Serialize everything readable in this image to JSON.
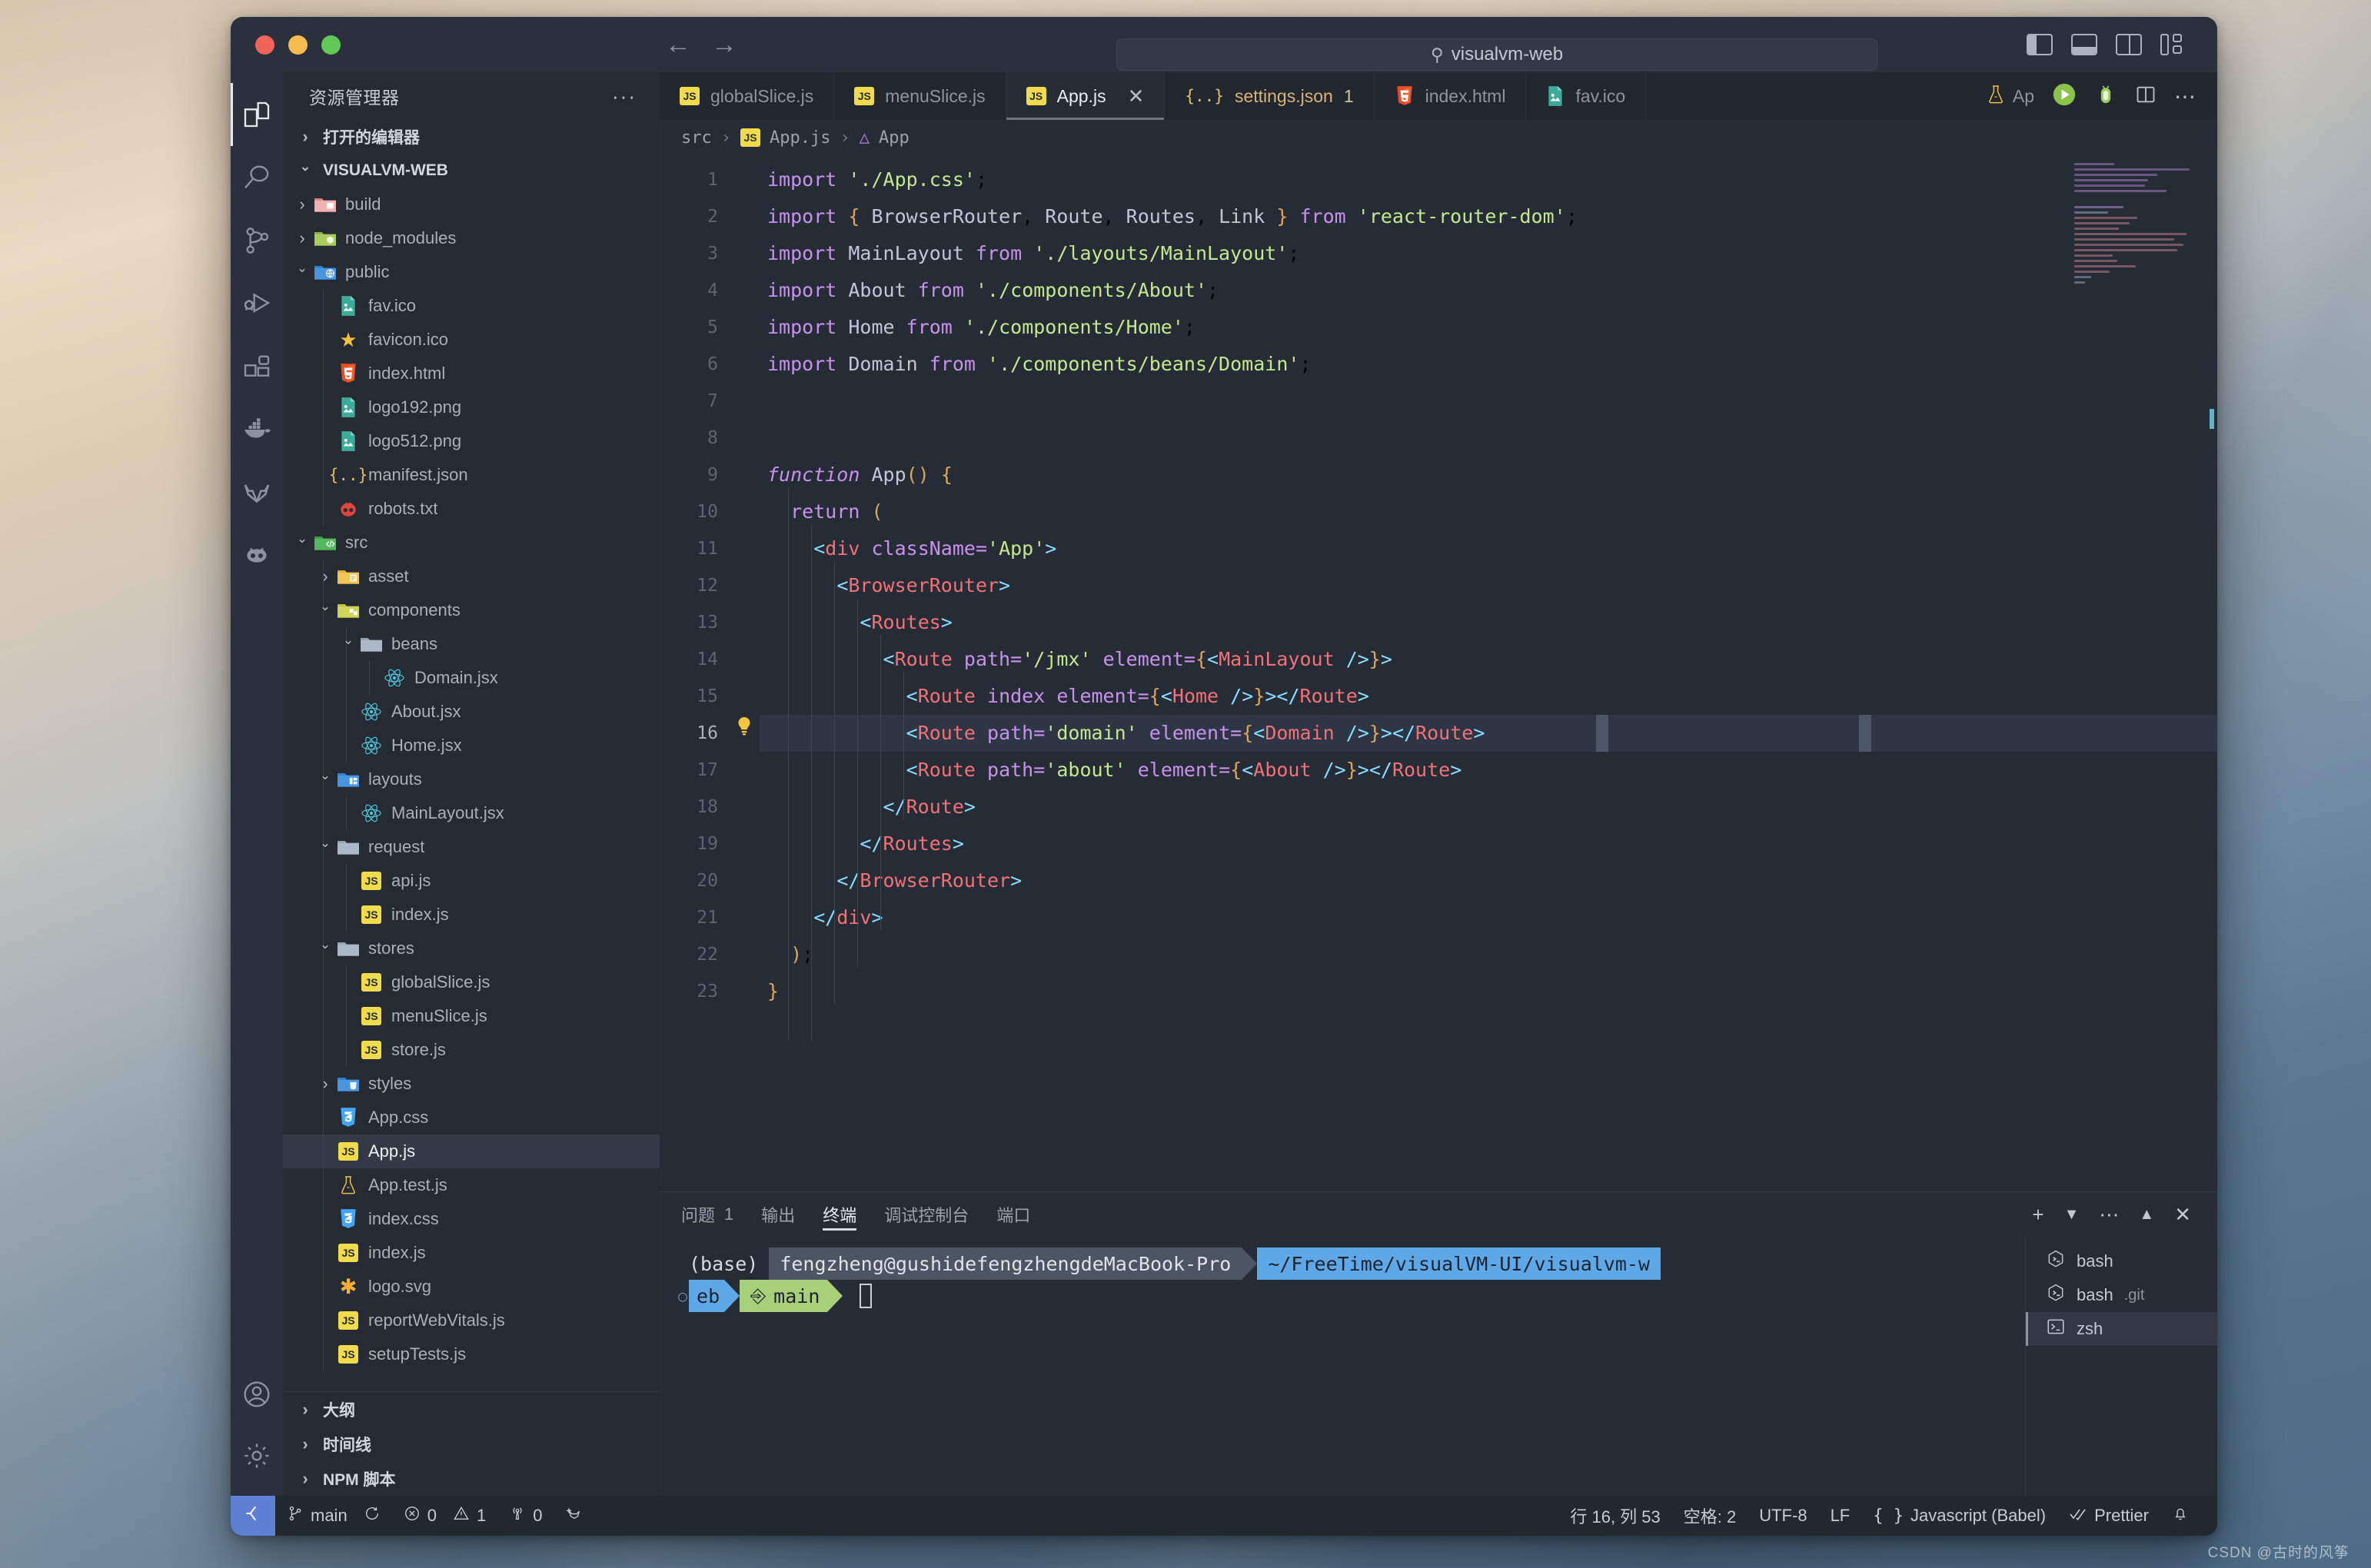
{
  "titlebar": {
    "quick_open_value": "visualvm-web",
    "quick_open_icon": "search-icon",
    "back_icon": "←",
    "forward_icon": "→",
    "traffic": [
      "close",
      "minimize",
      "zoom"
    ],
    "layout_buttons": [
      "toggle-primary-sidebar",
      "toggle-panel",
      "toggle-secondary-sidebar",
      "customize-layout"
    ]
  },
  "activitybar": {
    "items": [
      {
        "name": "explorer",
        "icon": "files-icon",
        "active": true
      },
      {
        "name": "search",
        "icon": "search-icon",
        "active": false
      },
      {
        "name": "source-control",
        "icon": "source-control-icon",
        "active": false
      },
      {
        "name": "run-and-debug",
        "icon": "run-debug-icon",
        "active": false
      },
      {
        "name": "extensions",
        "icon": "extensions-icon",
        "active": false
      },
      {
        "name": "docker",
        "icon": "docker-whale-icon",
        "active": false
      },
      {
        "name": "gitlab",
        "icon": "gitlab-fox-icon",
        "active": false
      },
      {
        "name": "codeium",
        "icon": "robot-icon",
        "active": false
      }
    ],
    "bottom": [
      {
        "name": "accounts",
        "icon": "account-icon"
      },
      {
        "name": "settings",
        "icon": "gear-icon"
      }
    ]
  },
  "sidebar": {
    "title": "资源管理器",
    "more_actions": "···",
    "open_editors_label": "打开的编辑器",
    "project_label": "VISUALVM-WEB",
    "tree": [
      {
        "label": "build",
        "depth": 1,
        "type": "folder",
        "state": "closed",
        "icon": "folder-build-icon"
      },
      {
        "label": "node_modules",
        "depth": 1,
        "type": "folder",
        "state": "closed",
        "icon": "folder-node-icon"
      },
      {
        "label": "public",
        "depth": 1,
        "type": "folder",
        "state": "open",
        "icon": "folder-public-icon"
      },
      {
        "label": "fav.ico",
        "depth": 2,
        "type": "file",
        "icon": "image-icon"
      },
      {
        "label": "favicon.ico",
        "depth": 2,
        "type": "file",
        "icon": "star-icon"
      },
      {
        "label": "index.html",
        "depth": 2,
        "type": "file",
        "icon": "html5-icon"
      },
      {
        "label": "logo192.png",
        "depth": 2,
        "type": "file",
        "icon": "image-icon"
      },
      {
        "label": "logo512.png",
        "depth": 2,
        "type": "file",
        "icon": "image-icon"
      },
      {
        "label": "manifest.json",
        "depth": 2,
        "type": "file",
        "icon": "json-icon"
      },
      {
        "label": "robots.txt",
        "depth": 2,
        "type": "file",
        "icon": "robots-icon"
      },
      {
        "label": "src",
        "depth": 1,
        "type": "folder",
        "state": "open",
        "icon": "folder-src-icon"
      },
      {
        "label": "asset",
        "depth": 2,
        "type": "folder",
        "state": "closed",
        "icon": "folder-asset-icon"
      },
      {
        "label": "components",
        "depth": 2,
        "type": "folder",
        "state": "open",
        "icon": "folder-components-icon"
      },
      {
        "label": "beans",
        "depth": 3,
        "type": "folder",
        "state": "open",
        "icon": "folder-icon"
      },
      {
        "label": "Domain.jsx",
        "depth": 4,
        "type": "file",
        "icon": "react-icon"
      },
      {
        "label": "About.jsx",
        "depth": 3,
        "type": "file",
        "icon": "react-icon"
      },
      {
        "label": "Home.jsx",
        "depth": 3,
        "type": "file",
        "icon": "react-icon"
      },
      {
        "label": "layouts",
        "depth": 2,
        "type": "folder",
        "state": "open",
        "icon": "folder-layout-icon"
      },
      {
        "label": "MainLayout.jsx",
        "depth": 3,
        "type": "file",
        "icon": "react-icon"
      },
      {
        "label": "request",
        "depth": 2,
        "type": "folder",
        "state": "open",
        "icon": "folder-icon"
      },
      {
        "label": "api.js",
        "depth": 3,
        "type": "file",
        "icon": "js-icon"
      },
      {
        "label": "index.js",
        "depth": 3,
        "type": "file",
        "icon": "js-icon"
      },
      {
        "label": "stores",
        "depth": 2,
        "type": "folder",
        "state": "open",
        "icon": "folder-icon"
      },
      {
        "label": "globalSlice.js",
        "depth": 3,
        "type": "file",
        "icon": "js-icon"
      },
      {
        "label": "menuSlice.js",
        "depth": 3,
        "type": "file",
        "icon": "js-icon"
      },
      {
        "label": "store.js",
        "depth": 3,
        "type": "file",
        "icon": "js-icon"
      },
      {
        "label": "styles",
        "depth": 2,
        "type": "folder",
        "state": "closed",
        "icon": "folder-styles-icon"
      },
      {
        "label": "App.css",
        "depth": 2,
        "type": "file",
        "icon": "css-icon"
      },
      {
        "label": "App.js",
        "depth": 2,
        "type": "file",
        "icon": "js-icon",
        "selected": true
      },
      {
        "label": "App.test.js",
        "depth": 2,
        "type": "file",
        "icon": "test-icon"
      },
      {
        "label": "index.css",
        "depth": 2,
        "type": "file",
        "icon": "css-icon"
      },
      {
        "label": "index.js",
        "depth": 2,
        "type": "file",
        "icon": "js-icon"
      },
      {
        "label": "logo.svg",
        "depth": 2,
        "type": "file",
        "icon": "svg-icon"
      },
      {
        "label": "reportWebVitals.js",
        "depth": 2,
        "type": "file",
        "icon": "js-icon"
      },
      {
        "label": "setupTests.js",
        "depth": 2,
        "type": "file",
        "icon": "js-icon"
      }
    ],
    "bottom_sections": [
      {
        "label": "大纲"
      },
      {
        "label": "时间线"
      },
      {
        "label": "NPM 脚本"
      }
    ]
  },
  "tabs": [
    {
      "label": "globalSlice.js",
      "icon": "js-icon",
      "active": false,
      "badge": ""
    },
    {
      "label": "menuSlice.js",
      "icon": "js-icon",
      "active": false,
      "badge": ""
    },
    {
      "label": "App.js",
      "icon": "js-icon",
      "active": true,
      "badge": "",
      "close": "×"
    },
    {
      "label": "settings.json",
      "icon": "json-icon",
      "active": false,
      "badge": "1"
    },
    {
      "label": "index.html",
      "icon": "html5-icon",
      "active": false,
      "badge": ""
    },
    {
      "label": "fav.ico",
      "icon": "image-icon",
      "active": false,
      "badge": ""
    }
  ],
  "tab_overflow": {
    "icon": "test-icon",
    "label": "Ap"
  },
  "tab_actions": [
    {
      "name": "run-button",
      "icon": "play-icon"
    },
    {
      "name": "debug-button",
      "icon": "bug-icon"
    },
    {
      "name": "split-editor-button",
      "icon": "split-icon"
    },
    {
      "name": "more-actions-button",
      "icon": "ellipsis-icon"
    }
  ],
  "breadcrumb": [
    "src",
    "App.js",
    "App"
  ],
  "breadcrumb_icons": [
    "",
    "js-icon",
    "symbol-icon"
  ],
  "editor": {
    "lines": [
      {
        "n": 1,
        "indent": 0
      },
      {
        "n": 2,
        "indent": 0
      },
      {
        "n": 3,
        "indent": 0
      },
      {
        "n": 4,
        "indent": 0
      },
      {
        "n": 5,
        "indent": 0
      },
      {
        "n": 6,
        "indent": 0
      },
      {
        "n": 7,
        "indent": 0
      },
      {
        "n": 8,
        "indent": 0
      },
      {
        "n": 9,
        "indent": 0
      },
      {
        "n": 10,
        "indent": 1
      },
      {
        "n": 11,
        "indent": 2
      },
      {
        "n": 12,
        "indent": 3
      },
      {
        "n": 13,
        "indent": 4
      },
      {
        "n": 14,
        "indent": 5
      },
      {
        "n": 15,
        "indent": 6
      },
      {
        "n": 16,
        "indent": 6,
        "highlight": true,
        "lamp": "💡"
      },
      {
        "n": 17,
        "indent": 6
      },
      {
        "n": 18,
        "indent": 5
      },
      {
        "n": 19,
        "indent": 4
      },
      {
        "n": 20,
        "indent": 3
      },
      {
        "n": 21,
        "indent": 2
      },
      {
        "n": 22,
        "indent": 1
      },
      {
        "n": 23,
        "indent": 0
      }
    ],
    "source": [
      "import './App.css';",
      "import { BrowserRouter, Route, Routes, Link } from 'react-router-dom';",
      "import MainLayout from './layouts/MainLayout';",
      "import About from './components/About';",
      "import Home from './components/Home';",
      "import Domain from './components/beans/Domain';",
      "",
      "",
      "function App() {",
      "  return (",
      "    <div className='App'>",
      "      <BrowserRouter>",
      "        <Routes>",
      "          <Route path='/jmx' element={<MainLayout />}>",
      "            <Route index element={<Home />}></Route>",
      "            <Route path='domain' element={<Domain />}></Route>",
      "            <Route path='about' element={<About />}></Route>",
      "          </Route>",
      "        </Routes>",
      "      </BrowserRouter>",
      "    </div>",
      "  );",
      "}"
    ]
  },
  "panel": {
    "tabs": [
      {
        "label": "问题",
        "count": "1",
        "active": false
      },
      {
        "label": "输出",
        "count": "",
        "active": false
      },
      {
        "label": "终端",
        "count": "",
        "active": true
      },
      {
        "label": "调试控制台",
        "count": "",
        "active": false
      },
      {
        "label": "端口",
        "count": "",
        "active": false
      }
    ],
    "actions": [
      {
        "name": "new-terminal-button",
        "icon": "plus-icon"
      },
      {
        "name": "terminal-kind-dropdown",
        "icon": "chevron-down-icon"
      },
      {
        "name": "panel-more-actions-button",
        "icon": "ellipsis-icon"
      },
      {
        "name": "maximize-panel-button",
        "icon": "chevron-up-icon"
      },
      {
        "name": "close-panel-button",
        "icon": "close-icon"
      }
    ],
    "terminal": {
      "env": "(base)",
      "host": "fengzheng@gushidefengzhengdeMacBook-Pro",
      "path_line1": "~/FreeTime/visualVM-UI/visualvm-w",
      "path_line2": "eb",
      "branch_icon": "git-branch-icon",
      "branch": "main",
      "cursor": "block-cursor"
    },
    "sessions": [
      {
        "label": "bash",
        "suffix": "",
        "icon": "bash-icon",
        "active": false
      },
      {
        "label": "bash",
        "suffix": ".git",
        "icon": "bash-icon",
        "active": false
      },
      {
        "label": "zsh",
        "suffix": "",
        "icon": "terminal-icon",
        "active": true
      }
    ]
  },
  "statusbar": {
    "remote_icon": "remote-window-icon",
    "left": [
      {
        "name": "branch",
        "icon": "git-branch-icon",
        "text": "main"
      },
      {
        "name": "sync",
        "icon": "sync-icon",
        "text": ""
      },
      {
        "name": "errors",
        "icon": "error-icon",
        "text": "0"
      },
      {
        "name": "warnings",
        "icon": "warning-icon",
        "text": "1"
      },
      {
        "name": "ports",
        "icon": "radio-tower-icon",
        "text": "0"
      },
      {
        "name": "gitlens",
        "icon": "gitlens-icon",
        "text": ""
      }
    ],
    "right": [
      {
        "name": "cursor-position",
        "text": "行 16, 列 53"
      },
      {
        "name": "indentation",
        "text": "空格: 2"
      },
      {
        "name": "encoding",
        "text": "UTF-8"
      },
      {
        "name": "eol",
        "text": "LF"
      },
      {
        "name": "language-mode",
        "icon": "braces-icon",
        "text": "Javascript (Babel)"
      },
      {
        "name": "prettier",
        "icon": "check-check-icon",
        "text": "Prettier"
      },
      {
        "name": "notifications",
        "icon": "bell-icon",
        "text": ""
      }
    ]
  },
  "watermark": "CSDN @古时的风筝"
}
